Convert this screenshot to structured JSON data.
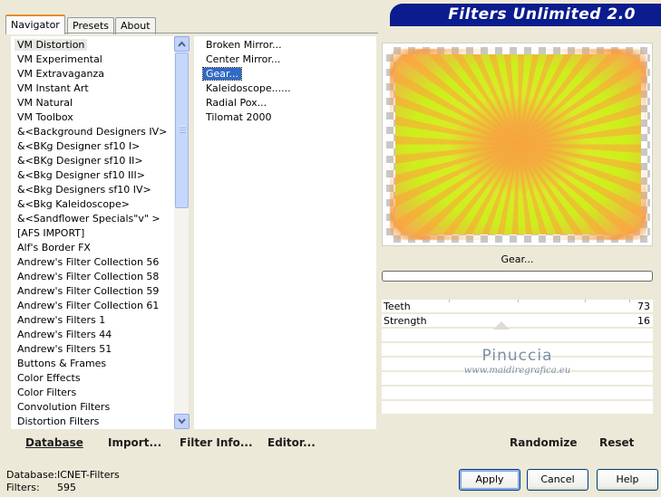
{
  "tabs": [
    {
      "label": "Navigator",
      "active": true
    },
    {
      "label": "Presets",
      "active": false
    },
    {
      "label": "About",
      "active": false
    }
  ],
  "banner_title": "Filters Unlimited 2.0",
  "categories": [
    "VM Distortion",
    "VM Experimental",
    "VM Extravaganza",
    "VM Instant Art",
    "VM Natural",
    "VM Toolbox",
    "&<Background Designers IV>",
    "&<BKg Designer sf10 I>",
    "&<BKg Designer sf10 II>",
    "&<Bkg Designer sf10 III>",
    "&<Bkg Designers sf10 IV>",
    "&<Bkg Kaleidoscope>",
    "&<Sandflower Specials\"v\" >",
    "[AFS IMPORT]",
    "Alf's Border FX",
    "Andrew's Filter Collection 56",
    "Andrew's Filter Collection 58",
    "Andrew's Filter Collection 59",
    "Andrew's Filter Collection 61",
    "Andrew's Filters 1",
    "Andrew's Filters 44",
    "Andrew's Filters 51",
    "Buttons & Frames",
    "Color Effects",
    "Color Filters",
    "Convolution Filters",
    "Distortion Filters"
  ],
  "selected_category": "VM Distortion",
  "filters": [
    "Broken Mirror...",
    "Center Mirror...",
    "Gear...",
    "Kaleidoscope......",
    "Radial Pox...",
    "Tilomat 2000"
  ],
  "selected_filter": "Gear...",
  "bottom_buttons": {
    "database": "Database",
    "import": "Import...",
    "filter_info": "Filter Info...",
    "editor": "Editor...",
    "randomize": "Randomize",
    "reset": "Reset"
  },
  "preview_filter_name": "Gear...",
  "progress": 0,
  "params": [
    {
      "label": "Teeth",
      "value": "73",
      "fraction": 0.29
    },
    {
      "label": "Strength",
      "value": "16",
      "fraction": 0
    }
  ],
  "watermark": {
    "title": "Pinuccia",
    "url": "www.maidiregrafica.eu"
  },
  "status": {
    "database_label": "Database:",
    "database_value": "ICNET-Filters",
    "filters_label": "Filters:",
    "filters_value": "595"
  },
  "dialog_buttons": {
    "apply": "Apply",
    "cancel": "Cancel",
    "help": "Help"
  },
  "colors": {
    "selection": "#316ac5",
    "banner": "#0b1c8e",
    "window_bg": "#ece9d8"
  }
}
